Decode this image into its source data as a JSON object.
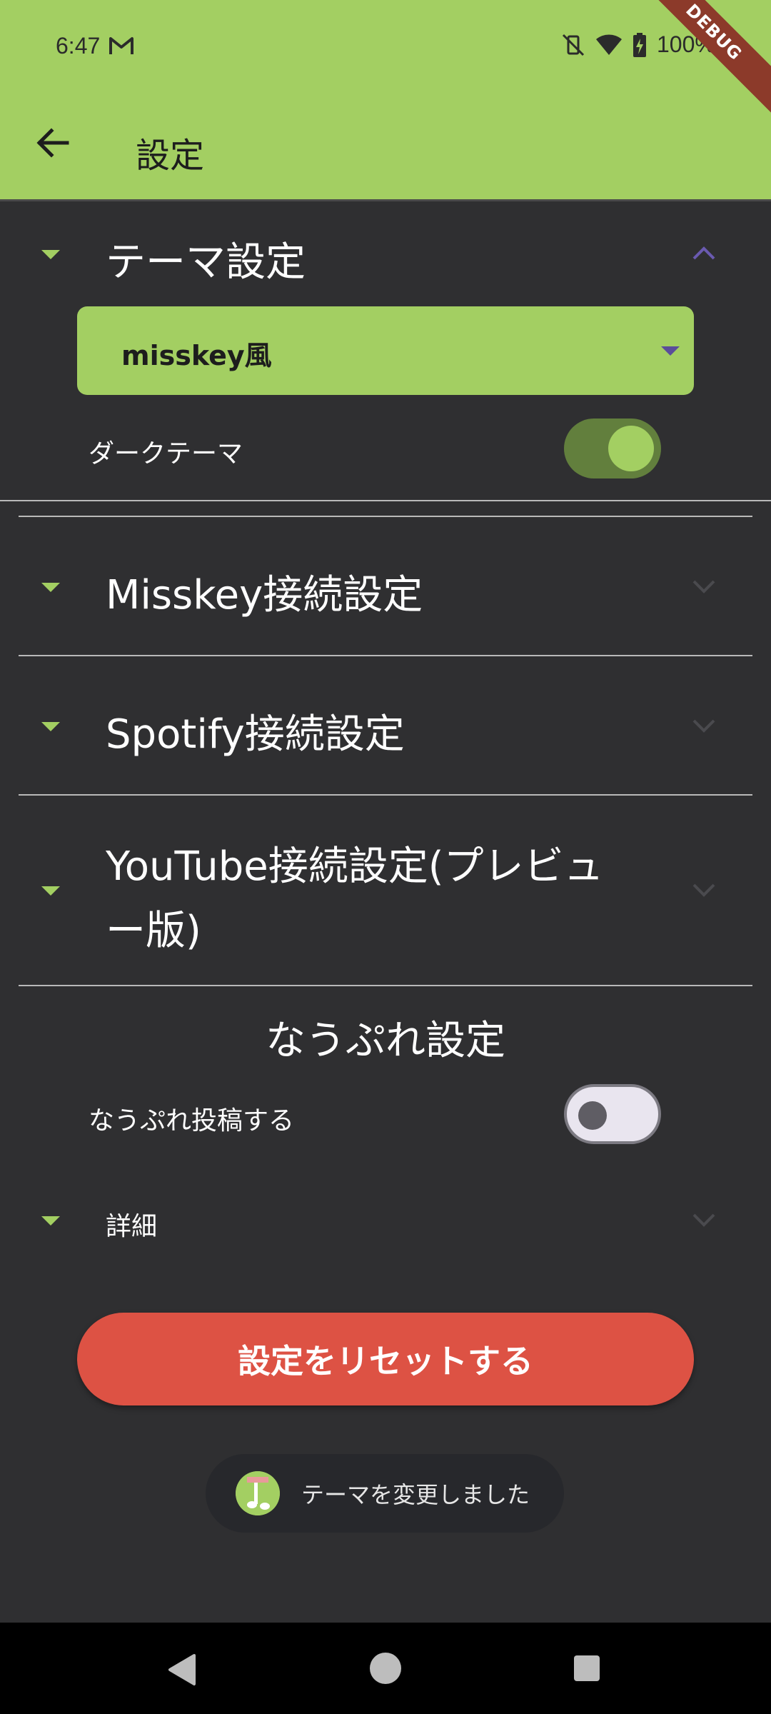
{
  "status_bar": {
    "time": "6:47",
    "battery": "100%",
    "debug_label": "DEBUG"
  },
  "app_bar": {
    "title": "設定"
  },
  "theme_section": {
    "title": "テーマ設定",
    "selected_theme": "misskey風",
    "dark_theme_label": "ダークテーマ",
    "dark_theme_on": true
  },
  "sections": {
    "misskey": "Misskey接続設定",
    "spotify": "Spotify接続設定",
    "youtube_line1": "YouTube接続設定(プレビュ",
    "youtube_line2": "ー版)"
  },
  "nowplaying": {
    "heading": "なうぷれ設定",
    "post_label": "なうぷれ投稿する",
    "post_on": false,
    "details": "詳細"
  },
  "reset_button": {
    "label": "設定をリセットする"
  },
  "toast": {
    "message": "テーマを変更しました"
  },
  "colors": {
    "accent": "#a3cf62",
    "background": "#2f2f31",
    "danger": "#dd5244"
  }
}
